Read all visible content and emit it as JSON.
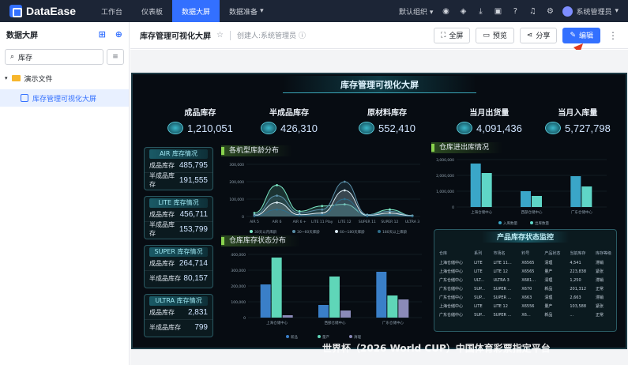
{
  "app": {
    "logo_text": "DataEase"
  },
  "nav": [
    "工作台",
    "仪表板",
    "数据大屏",
    "数据准备"
  ],
  "nav_active": "数据大屏",
  "topbar": {
    "org": "默认组织",
    "user": "系统管理员"
  },
  "sidebar": {
    "title": "数据大屏",
    "search_value": "库存",
    "folder": "演示文件",
    "item": "库存管理可视化大屏"
  },
  "header": {
    "title": "库存管理可视化大屏",
    "creator": "创建人:系统管理员",
    "btn_fullscreen": "全屏",
    "btn_preview": "预览",
    "btn_share": "分享",
    "btn_edit": "编辑"
  },
  "screen": {
    "title": "库存管理可视化大屏",
    "kpis": [
      {
        "label": "成品库存",
        "value": "1,210,051"
      },
      {
        "label": "半成品库存",
        "value": "426,310"
      },
      {
        "label": "原材料库存",
        "value": "552,410"
      },
      {
        "label": "当月出货量",
        "value": "4,091,436"
      },
      {
        "label": "当月入库量",
        "value": "5,727,798"
      }
    ],
    "cards": [
      {
        "title": "AIR 库存情况",
        "rows": [
          {
            "label": "成品库存",
            "value": "485,795"
          },
          {
            "label": "半成品库存",
            "value": "191,555"
          }
        ]
      },
      {
        "title": "LITE 库存情况",
        "rows": [
          {
            "label": "成品库存",
            "value": "456,711"
          },
          {
            "label": "半成品库存",
            "value": "153,799"
          }
        ]
      },
      {
        "title": "SUPER 库存情况",
        "rows": [
          {
            "label": "成品库存",
            "value": "264,714"
          },
          {
            "label": "半成品库存",
            "value": "80,157"
          }
        ]
      },
      {
        "title": "ULTRA 库存情况",
        "rows": [
          {
            "label": "成品库存",
            "value": "2,831"
          },
          {
            "label": "半成品库存",
            "value": "799"
          }
        ]
      }
    ],
    "panel_titles": {
      "age": "各机型库龄分布",
      "inout": "仓库进出库情况",
      "status": "仓库库存状态分布",
      "monitor": "产品库存状态监控"
    },
    "monitor": {
      "headers": [
        "仓库",
        "系列",
        "市场名",
        "料号",
        "产品状态",
        "当前库存",
        "库存等级"
      ],
      "rows": [
        [
          "上海仓储中心",
          "LITE",
          "LITE 11...",
          "X6565",
          "清理",
          "4,541",
          "滞销"
        ],
        [
          "上海仓储中心",
          "LITE",
          "LITE 12",
          "X6565",
          "量产",
          "223,838",
          "紧张"
        ],
        [
          "广东仓储中心",
          "ULT...",
          "ULTRA 3",
          "X681...",
          "清理",
          "1,250",
          "滞销"
        ],
        [
          "广东仓储中心",
          "SUP...",
          "SUPER ...",
          "X670",
          "新品",
          "201,312",
          "正常"
        ],
        [
          "广东仓储中心",
          "SUP...",
          "SUPER ...",
          "X663",
          "清理",
          "2,663",
          "滞销"
        ],
        [
          "上海仓储中心",
          "LITE",
          "LITE 12",
          "X6556",
          "量产",
          "103,588",
          "紧张"
        ],
        [
          "广东仓储中心",
          "SUP...",
          "SUPER ...",
          "X6...",
          "新品",
          "...",
          "正常"
        ]
      ]
    }
  },
  "watermark": "世界杯（2026 World CUP）中国体育彩票指定平台",
  "chart_data": [
    {
      "type": "area",
      "title": "各机型库龄分布",
      "categories": [
        "AIR 5",
        "AIR 6",
        "AIR 6 +",
        "LITE 11 Play",
        "LITE 12",
        "SUPER 11",
        "SUPER 12",
        "ULTRA 3"
      ],
      "ylim": [
        0,
        300000
      ],
      "yticks": [
        "300,000",
        "200,000",
        "100,000",
        "0"
      ],
      "series": [
        {
          "name": "30天以内库龄",
          "values": [
            20000,
            180000,
            30000,
            60000,
            70000,
            10000,
            40000,
            5000
          ]
        },
        {
          "name": "30~60天库龄",
          "values": [
            10000,
            120000,
            20000,
            40000,
            200000,
            10000,
            30000,
            5000
          ]
        },
        {
          "name": "60~180天库龄",
          "values": [
            5000,
            80000,
            10000,
            20000,
            150000,
            5000,
            20000,
            3000
          ]
        },
        {
          "name": "180天以上库龄",
          "values": [
            2000,
            40000,
            5000,
            10000,
            100000,
            2000,
            10000,
            1000
          ]
        }
      ],
      "colors": [
        "#7ce8c6",
        "#5a8fa8",
        "#d8e8f0",
        "#2e6d8a"
      ]
    },
    {
      "type": "bar",
      "title": "仓库进出库情况",
      "categories": [
        "上海仓储中心",
        "西部仓储中心",
        "广东仓储中心"
      ],
      "ylim": [
        0,
        3000000
      ],
      "yticks": [
        "3,000,000",
        "2,000,000",
        "1,000,000",
        "0"
      ],
      "series": [
        {
          "name": "入库数量",
          "values": [
            2750000,
            1000000,
            1950000
          ]
        },
        {
          "name": "出库数量",
          "values": [
            2150000,
            700000,
            1300000
          ]
        }
      ],
      "colors": [
        "#3aa6c8",
        "#5fd6c7"
      ]
    },
    {
      "type": "bar",
      "title": "仓库库存状态分布",
      "categories": [
        "上海仓储中心",
        "西部仓储中心",
        "广东仓储中心"
      ],
      "ylim": [
        0,
        400000
      ],
      "yticks": [
        "400,000",
        "300,000",
        "200,000",
        "100,000",
        "0"
      ],
      "series": [
        {
          "name": "新品",
          "values": [
            210000,
            80000,
            290000
          ]
        },
        {
          "name": "量产",
          "values": [
            380000,
            260000,
            140000
          ]
        },
        {
          "name": "清理",
          "values": [
            15000,
            45000,
            115000
          ]
        }
      ],
      "colors": [
        "#3a7fc8",
        "#5fd6b8",
        "#8a8ab8"
      ]
    }
  ]
}
